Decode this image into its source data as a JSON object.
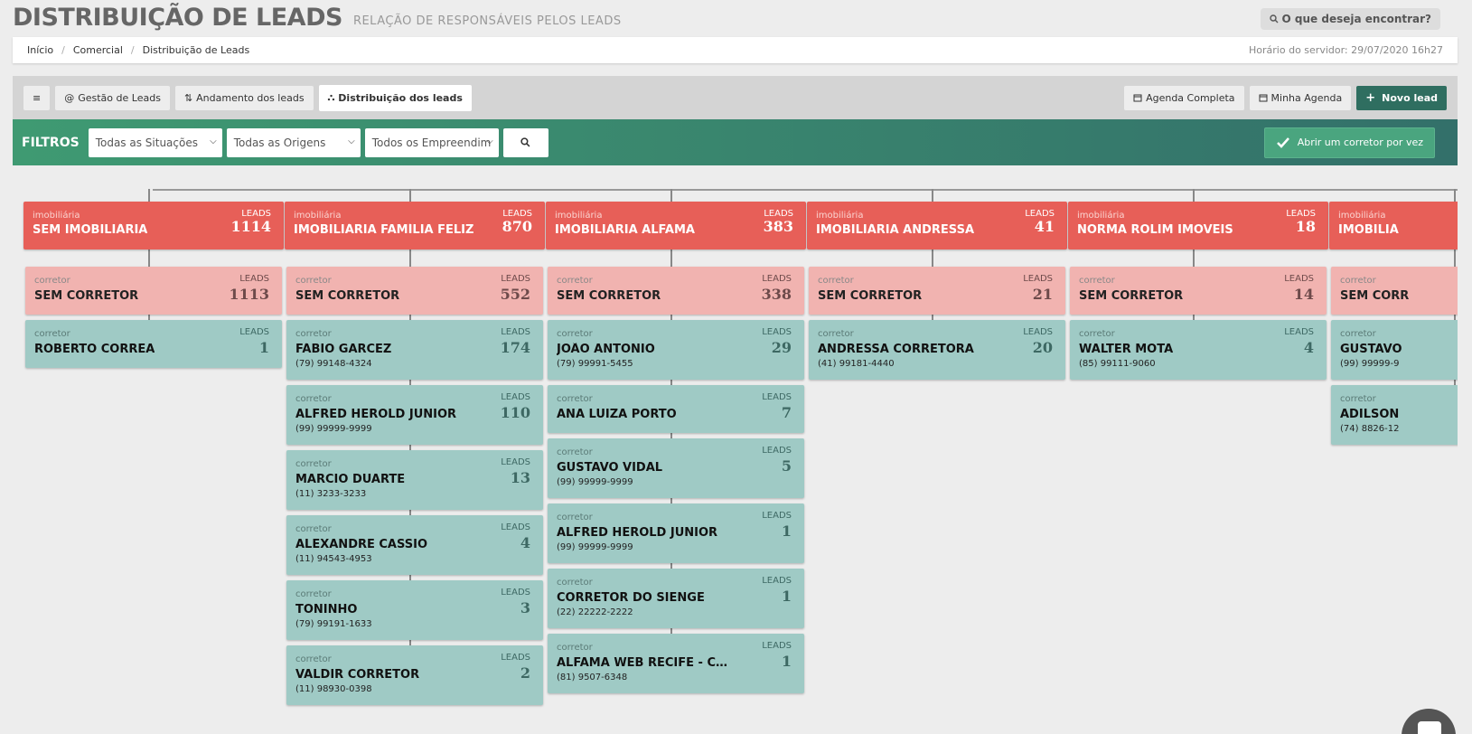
{
  "header": {
    "title": "DISTRIBUIÇÃO DE LEADS",
    "subtitle": "RELAÇÃO DE RESPONSÁVEIS PELOS LEADS",
    "search_label": "O que deseja encontrar?"
  },
  "breadcrumb": {
    "items": [
      "Início",
      "Comercial",
      "Distribuição de Leads"
    ],
    "server_time": "Horário do servidor: 29/07/2020 16h27"
  },
  "toolbar": {
    "menu_icon": "≡",
    "tabs": [
      {
        "icon": "@",
        "label": "Gestão de Leads"
      },
      {
        "icon": "⇅",
        "label": "Andamento dos leads"
      },
      {
        "icon": "⛬",
        "label": "Distribuição dos leads"
      }
    ],
    "actions": [
      {
        "label": "Agenda Completa"
      },
      {
        "label": "Minha Agenda"
      },
      {
        "label": "Novo lead"
      }
    ]
  },
  "filters": {
    "label": "FILTROS",
    "situacao": "Todas as Situações",
    "origem": "Todas as Origens",
    "empreendimento": "Todos os Empreendim",
    "open_button": "Abrir um corretor por vez"
  },
  "labels": {
    "imob": "imobiliária",
    "corretor": "corretor",
    "leads": "LEADS"
  },
  "columns": [
    {
      "name": "SEM IMOBILIÁRIA",
      "leads": "1114",
      "brokers": [
        {
          "name": "SEM CORRETOR",
          "leads": "1113",
          "phone": ""
        },
        {
          "name": "ROBERTO CORREA",
          "leads": "1",
          "phone": ""
        }
      ]
    },
    {
      "name": "IMOBILIÁRIA FAMÍLIA FELIZ",
      "leads": "870",
      "brokers": [
        {
          "name": "SEM CORRETOR",
          "leads": "552",
          "phone": ""
        },
        {
          "name": "FÁBIO GARCEZ",
          "leads": "174",
          "phone": "(79) 99148-4324"
        },
        {
          "name": "ALFRED HEROLD JUNIOR",
          "leads": "110",
          "phone": "(99) 99999-9999"
        },
        {
          "name": "MARCIO DUARTE",
          "leads": "13",
          "phone": "(11) 3233-3233"
        },
        {
          "name": "ALEXANDRE CASSIO",
          "leads": "4",
          "phone": "(11) 94543-4953"
        },
        {
          "name": "TONINHO",
          "leads": "3",
          "phone": "(79) 99191-1633"
        },
        {
          "name": "VALDIR CORRETOR",
          "leads": "2",
          "phone": "(11) 98930-0398"
        }
      ]
    },
    {
      "name": "IMOBILIÁRIA ALFAMA",
      "leads": "383",
      "brokers": [
        {
          "name": "SEM CORRETOR",
          "leads": "338",
          "phone": ""
        },
        {
          "name": "JOÃO ANTÔNIO",
          "leads": "29",
          "phone": "(79) 99991-5455"
        },
        {
          "name": "ANA LUIZA PORTO",
          "leads": "7",
          "phone": ""
        },
        {
          "name": "GUSTAVO VIDAL",
          "leads": "5",
          "phone": "(99) 99999-9999"
        },
        {
          "name": "ALFRED HEROLD JUNIOR",
          "leads": "1",
          "phone": "(99) 99999-9999"
        },
        {
          "name": "CORRETOR DO SIENGE",
          "leads": "1",
          "phone": "(22) 22222-2222"
        },
        {
          "name": "ALFAMA WEB RECIFE - CORR...",
          "leads": "1",
          "phone": "(81) 9507-6348"
        }
      ]
    },
    {
      "name": "IMOBILIÁRIA ANDRESSA",
      "leads": "41",
      "brokers": [
        {
          "name": "SEM CORRETOR",
          "leads": "21",
          "phone": ""
        },
        {
          "name": "ANDRESSA CORRETORA",
          "leads": "20",
          "phone": "(41) 99181-4440"
        }
      ]
    },
    {
      "name": "NORMA ROLIM IMOVEIS",
      "leads": "18",
      "brokers": [
        {
          "name": "SEM CORRETOR",
          "leads": "14",
          "phone": ""
        },
        {
          "name": "WALTER MOTA",
          "leads": "4",
          "phone": "(85) 99111-9060"
        }
      ]
    },
    {
      "name": "IMOBILIÁ",
      "leads": "",
      "brokers": [
        {
          "name": "SEM CORR",
          "leads": "",
          "phone": ""
        },
        {
          "name": "GUSTAVO",
          "leads": "",
          "phone": "(99) 99999-9"
        },
        {
          "name": "ADILSON",
          "leads": "",
          "phone": "(74) 8826-12"
        }
      ]
    }
  ]
}
